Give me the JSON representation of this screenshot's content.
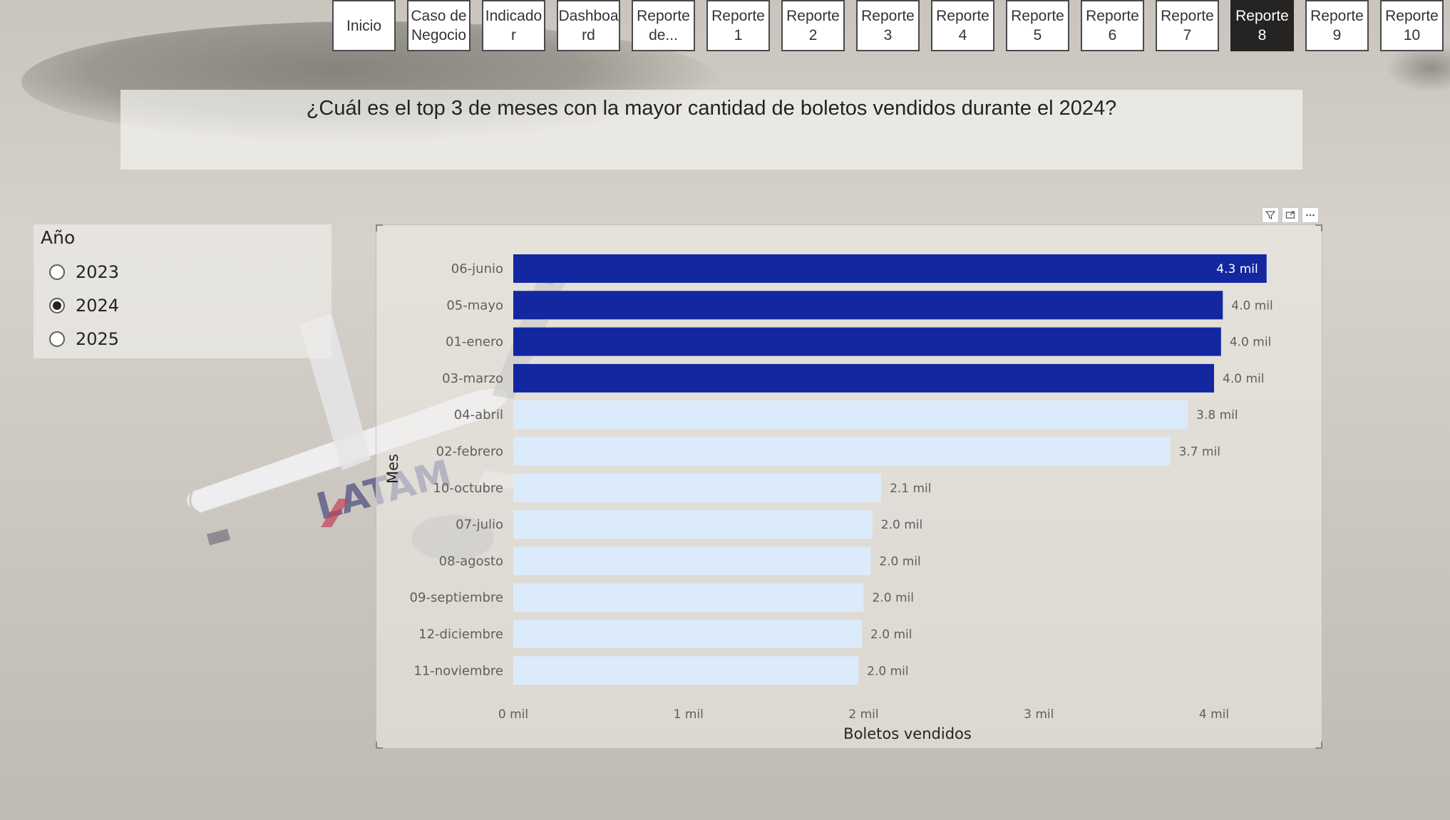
{
  "nav": {
    "buttons": [
      {
        "label": "Inicio",
        "active": false
      },
      {
        "label": "Caso de\nNegocio",
        "active": false
      },
      {
        "label": "Indicado\nr",
        "active": false
      },
      {
        "label": "Dashboa\nrd",
        "active": false
      },
      {
        "label": "Reporte\nde...",
        "active": false
      },
      {
        "label": "Reporte\n1",
        "active": false
      },
      {
        "label": "Reporte\n2",
        "active": false
      },
      {
        "label": "Reporte\n3",
        "active": false
      },
      {
        "label": "Reporte\n4",
        "active": false
      },
      {
        "label": "Reporte\n5",
        "active": false
      },
      {
        "label": "Reporte\n6",
        "active": false
      },
      {
        "label": "Reporte\n7",
        "active": false
      },
      {
        "label": "Reporte\n8",
        "active": true
      },
      {
        "label": "Reporte\n9",
        "active": false
      },
      {
        "label": "Reporte\n10",
        "active": false
      }
    ]
  },
  "question": "¿Cuál es el top 3 de meses con la mayor cantidad de boletos vendidos durante el 2024?",
  "slicer": {
    "title": "Año",
    "options": [
      {
        "label": "2023",
        "selected": false
      },
      {
        "label": "2024",
        "selected": true
      },
      {
        "label": "2025",
        "selected": false
      }
    ]
  },
  "background_logo_text": "LATAM",
  "chart_tools": {
    "filter_icon": "filter-icon",
    "focus_icon": "focus-mode-icon",
    "more_icon": "more-options-icon"
  },
  "chart_data": {
    "type": "bar",
    "orientation": "horizontal",
    "categories": [
      "06-junio",
      "05-mayo",
      "01-enero",
      "03-marzo",
      "04-abril",
      "02-febrero",
      "10-octubre",
      "07-julio",
      "08-agosto",
      "09-septiembre",
      "12-diciembre",
      "11-noviembre"
    ],
    "values": [
      4300,
      4050,
      4040,
      4000,
      3850,
      3750,
      2100,
      2050,
      2040,
      2000,
      1990,
      1970
    ],
    "data_labels": [
      "4.3 mil",
      "4.0 mil",
      "4.0 mil",
      "4.0 mil",
      "3.8 mil",
      "3.7 mil",
      "2.1 mil",
      "2.0 mil",
      "2.0 mil",
      "2.0 mil",
      "2.0 mil",
      "2.0 mil"
    ],
    "highlighted": [
      true,
      true,
      true,
      true,
      false,
      false,
      false,
      false,
      false,
      false,
      false,
      false
    ],
    "xlabel": "Boletos vendidos",
    "ylabel": "Mes",
    "xticks": [
      0,
      1000,
      2000,
      3000,
      4000
    ],
    "xtick_labels": [
      "0 mil",
      "1 mil",
      "2 mil",
      "3 mil",
      "4 mil"
    ],
    "xlim": [
      0,
      4500
    ],
    "colors": {
      "highlight": "#1227a0",
      "normal": "#dcebfb",
      "label_inside": "#ffffff",
      "label_outside": "#605e5c"
    }
  }
}
